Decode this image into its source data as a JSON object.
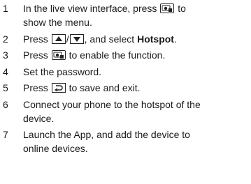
{
  "steps": [
    {
      "num": "1",
      "parts": [
        "In the live view interface, press",
        "to",
        "show the menu."
      ]
    },
    {
      "num": "2",
      "parts": [
        "Press",
        "/",
        ", and select",
        "Hotspot",
        "."
      ]
    },
    {
      "num": "3",
      "parts": [
        "Press",
        "to enable the function."
      ]
    },
    {
      "num": "4",
      "parts": [
        "Set the password."
      ]
    },
    {
      "num": "5",
      "parts": [
        "Press",
        "to save and exit."
      ]
    },
    {
      "num": "6",
      "parts": [
        "Connect your phone to the hotspot of the",
        "device."
      ]
    },
    {
      "num": "7",
      "parts": [
        "Launch the App, and add the device to",
        "online devices."
      ]
    }
  ],
  "icons": {
    "menu_key": "menu-key-icon",
    "up_key": "up-arrow-key-icon",
    "down_key": "down-arrow-key-icon",
    "back_key": "back-key-icon"
  }
}
